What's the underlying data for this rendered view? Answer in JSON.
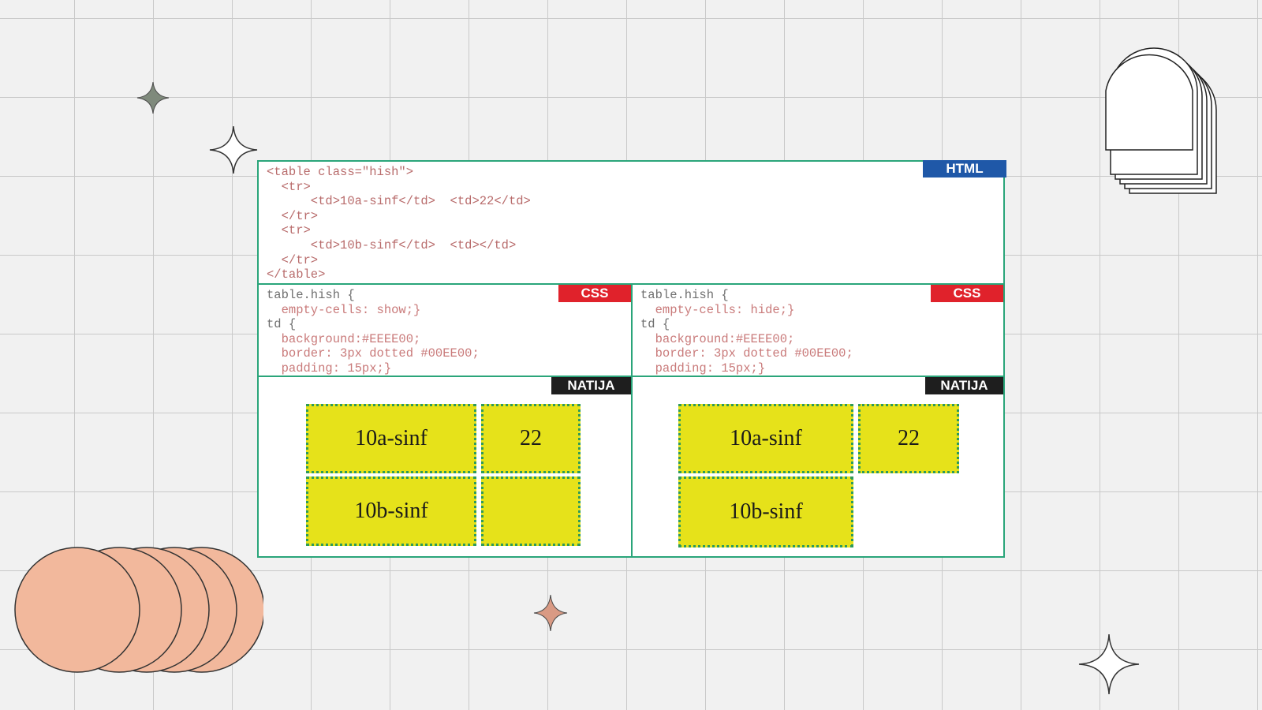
{
  "html_panel": {
    "badge": "HTML",
    "lines": [
      "<table class=\"hish\">",
      "  <tr>",
      "      <td>10a-sinf</td>  <td>22</td>",
      "  </tr>",
      "  <tr>",
      "      <td>10b-sinf</td>  <td></td>",
      "  </tr>",
      "</table>"
    ]
  },
  "css_left": {
    "badge": "CSS",
    "lines": [
      "table.hish {",
      "  empty-cells: show;}",
      "td {",
      "  background:#EEEE00;",
      "  border: 3px dotted #00EE00;",
      "  padding: 15px;}"
    ]
  },
  "css_right": {
    "badge": "CSS",
    "lines": [
      "table.hish {",
      "  empty-cells: hide;}",
      "td {",
      "  background:#EEEE00;",
      "  border: 3px dotted #00EE00;",
      "  padding: 15px;}"
    ]
  },
  "result_left": {
    "badge": "NATIJA",
    "cells": [
      "10a-sinf",
      "22",
      "10b-sinf",
      ""
    ]
  },
  "result_right": {
    "badge": "NATIJA",
    "cells": [
      "10a-sinf",
      "22",
      "10b-sinf"
    ]
  },
  "colors": {
    "html_badge": "#1f58a8",
    "css_badge": "#e0222b",
    "natija_badge": "#1e1e1e",
    "frame": "#2aa57a",
    "cell_fill": "#e6e21a",
    "cell_border": "#2e9a5a",
    "circles": "#f2b89c"
  },
  "decorations": [
    "sparkle-icon",
    "arch-stack-icon",
    "circle-stack-icon"
  ]
}
